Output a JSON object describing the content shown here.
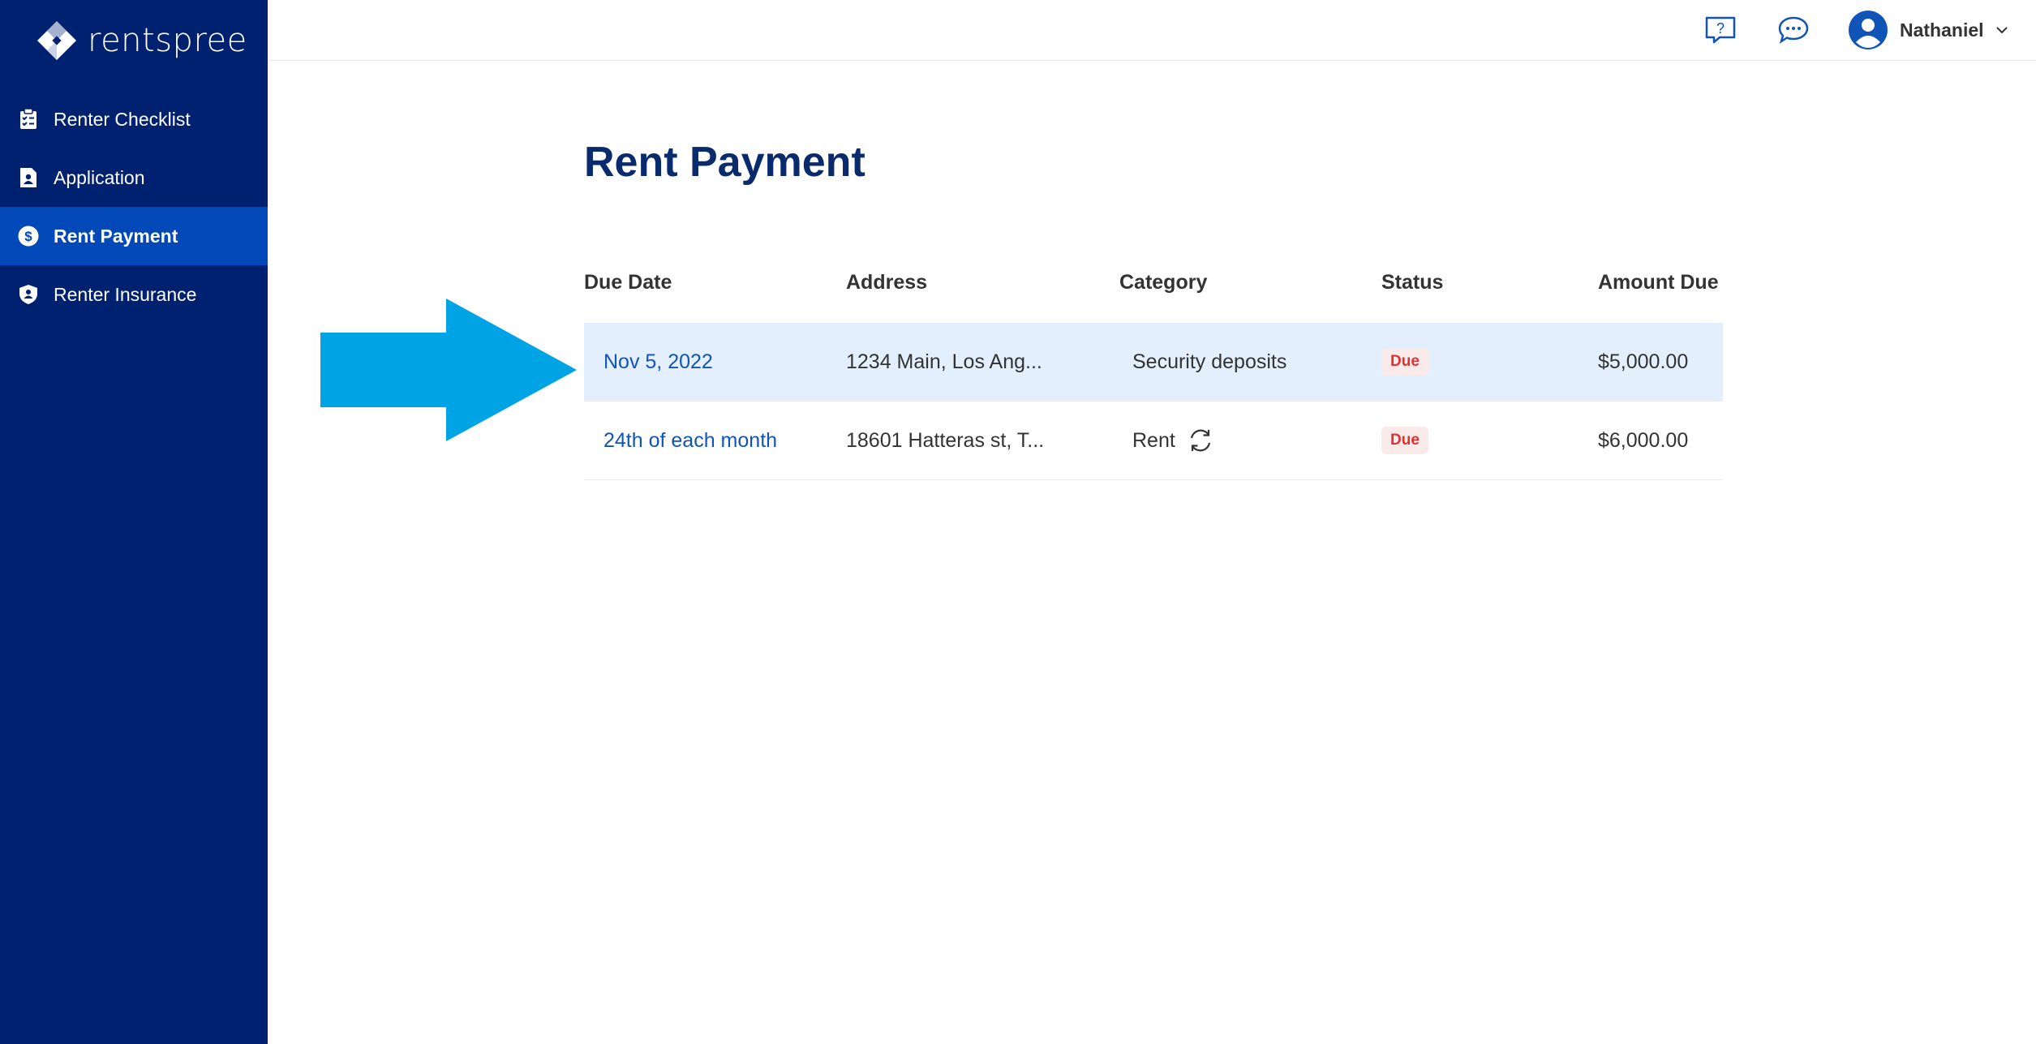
{
  "app": {
    "brand": "rentspree"
  },
  "sidebar": {
    "items": [
      {
        "label": "Renter Checklist",
        "icon": "clipboard-check-icon"
      },
      {
        "label": "Application",
        "icon": "document-user-icon"
      },
      {
        "label": "Rent Payment",
        "icon": "dollar-circle-icon",
        "active": true
      },
      {
        "label": "Renter Insurance",
        "icon": "shield-user-icon"
      }
    ]
  },
  "topbar": {
    "user_name": "Nathaniel",
    "icons": [
      "help-chat-icon",
      "message-bubble-icon",
      "avatar-icon",
      "chevron-down-icon"
    ]
  },
  "main": {
    "title": "Rent Payment",
    "columns": [
      "Due Date",
      "Address",
      "Category",
      "Status",
      "Amount Due"
    ],
    "rows": [
      {
        "due_date": "Nov 5, 2022",
        "address": "1234 Main, Los Ang...",
        "category": "Security deposits",
        "status": "Due",
        "amount": "$5,000.00",
        "recurring": false
      },
      {
        "due_date": "24th of each month",
        "address": "18601 Hatteras st, T...",
        "category": "Rent",
        "status": "Due",
        "amount": "$6,000.00",
        "recurring": true
      }
    ]
  },
  "colors": {
    "sidebar_bg": "#002070",
    "sidebar_active": "#0248b8",
    "title": "#0a2a6e",
    "link": "#1154b8",
    "row_highlight": "#e3effd",
    "badge_bg": "#fbeaea",
    "badge_text": "#dd3333",
    "arrow": "#00a3e4"
  }
}
